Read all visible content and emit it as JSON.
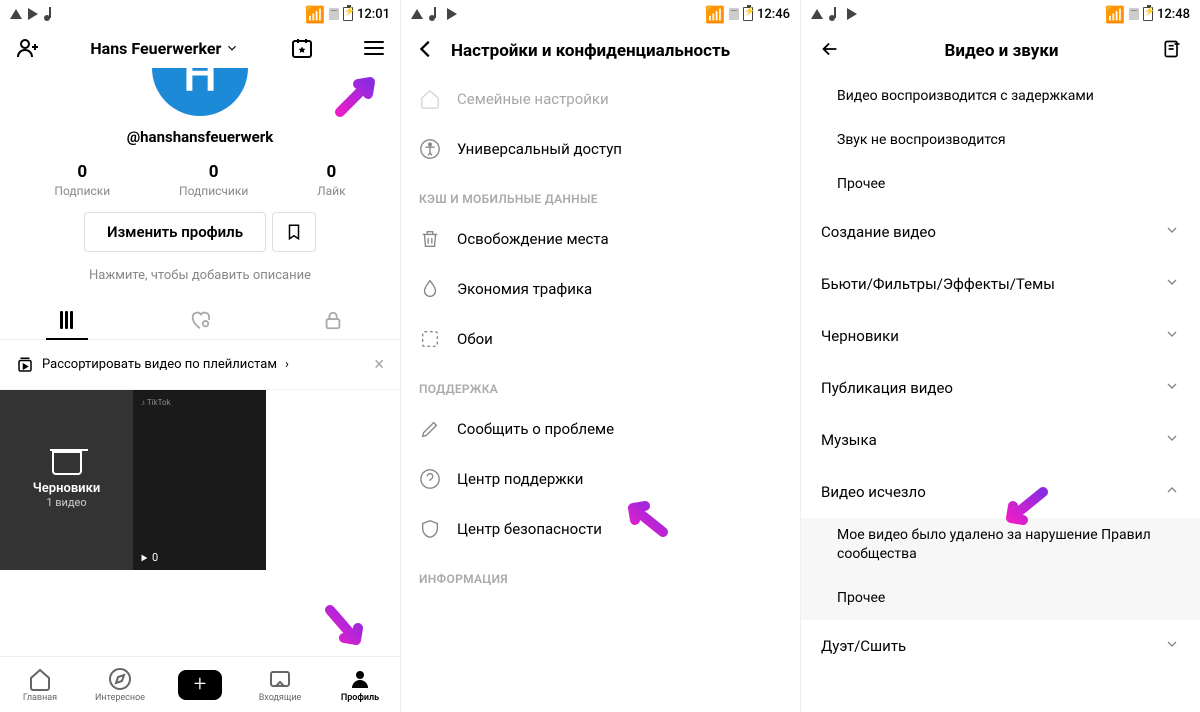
{
  "p1": {
    "status_time": "12:01",
    "display_name": "Hans Feuerwerker",
    "avatar_letter": "H",
    "username": "@hanshansfeuerwerk",
    "stats": [
      {
        "num": "0",
        "lbl": "Подписки"
      },
      {
        "num": "0",
        "lbl": "Подписчики"
      },
      {
        "num": "0",
        "lbl": "Лайк"
      }
    ],
    "edit_btn": "Изменить профиль",
    "bio_hint": "Нажмите, чтобы добавить описание",
    "playlist_hint": "Рассортировать видео по плейлистам",
    "drafts_title": "Черновики",
    "drafts_sub": "1 видео",
    "video_count": "0",
    "nav": {
      "home": "Главная",
      "discover": "Интересное",
      "inbox": "Входящие",
      "profile": "Профиль"
    }
  },
  "p2": {
    "status_time": "12:46",
    "title": "Настройки и конфиденциальность",
    "item_family": "Семейные настройки",
    "item_access": "Универсальный доступ",
    "sect_cache": "КЭШ И МОБИЛЬНЫЕ ДАННЫЕ",
    "item_clear": "Освобождение места",
    "item_data": "Экономия трафика",
    "item_wall": "Обои",
    "sect_support": "ПОДДЕРЖКА",
    "item_report": "Сообщить о проблеме",
    "item_help": "Центр поддержки",
    "item_safety": "Центр безопасности",
    "sect_info": "ИНФОРМАЦИЯ"
  },
  "p3": {
    "status_time": "12:48",
    "title": "Видео и звуки",
    "sub_lag": "Видео воспроизводится с задержками",
    "sub_nosound": "Звук не воспроизводится",
    "sub_other1": "Прочее",
    "item_create": "Создание видео",
    "item_beauty": "Бьюти/Фильтры/Эффекты/Темы",
    "item_drafts": "Черновики",
    "item_publish": "Публикация видео",
    "item_music": "Музыка",
    "item_gone": "Видео исчезло",
    "sub_removed": "Мое видео было удалено за нарушение Правил сообщества",
    "sub_other2": "Прочее",
    "item_duet": "Дуэт/Сшить"
  }
}
